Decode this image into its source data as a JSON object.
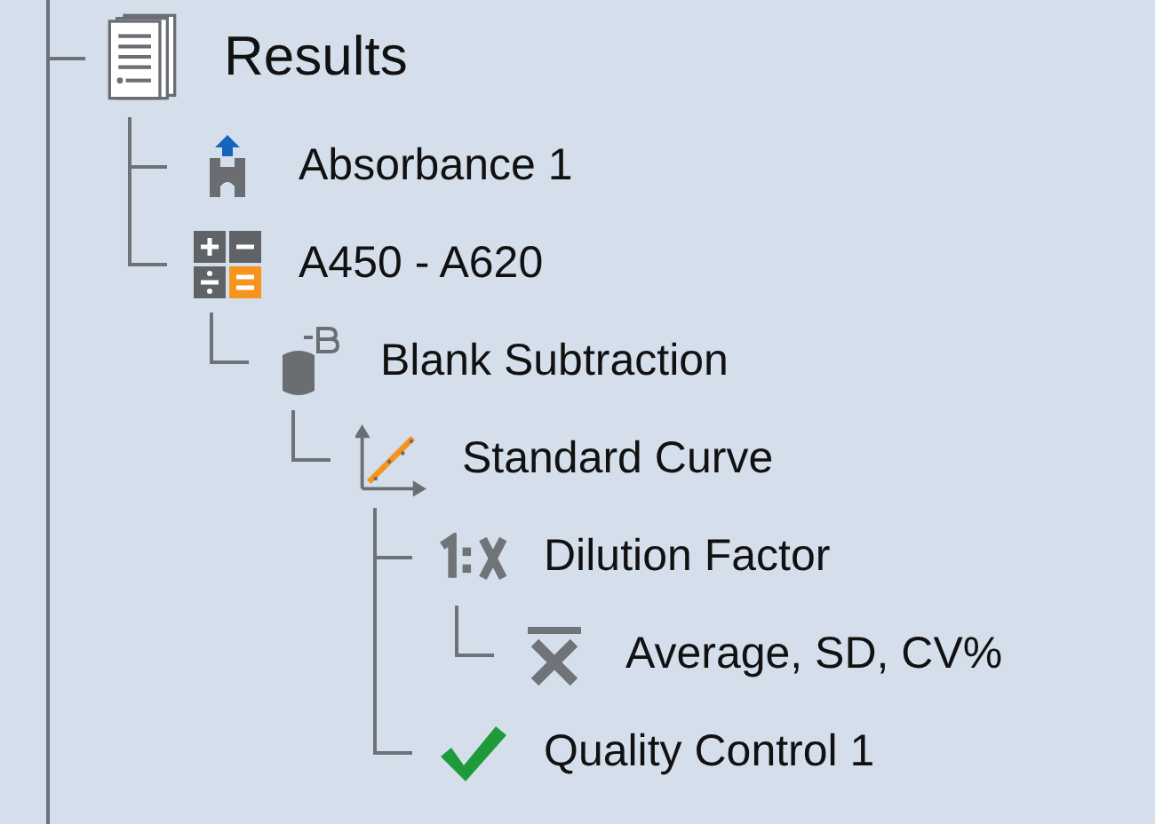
{
  "tree": [
    {
      "label": "Results",
      "kind": "results",
      "children": [
        {
          "label": "Absorbance 1",
          "kind": "absorbance"
        },
        {
          "label": "A450 - A620",
          "kind": "calculation",
          "children": [
            {
              "label": "Blank Subtraction",
              "kind": "blank",
              "children": [
                {
                  "label": "Standard Curve",
                  "kind": "curve",
                  "children": [
                    {
                      "label": "Dilution Factor",
                      "kind": "dilution",
                      "children": [
                        {
                          "label": "Average, SD, CV%",
                          "kind": "average"
                        }
                      ]
                    },
                    {
                      "label": "Quality Control 1",
                      "kind": "qc"
                    }
                  ]
                }
              ]
            }
          ]
        }
      ]
    }
  ]
}
